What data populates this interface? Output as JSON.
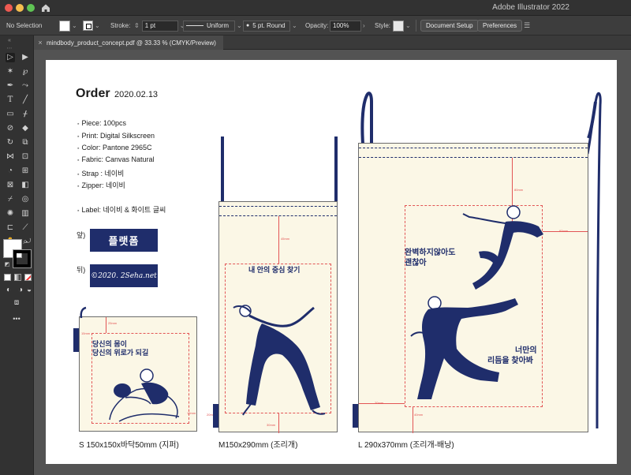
{
  "app": {
    "title": "Adobe Illustrator 2022"
  },
  "control_bar": {
    "selection": "No Selection",
    "stroke_label": "Stroke:",
    "stroke_weight": "1 pt",
    "profile": "Uniform",
    "brush": "5 pt. Round",
    "opacity_label": "Opacity:",
    "opacity_value": "100%",
    "style_label": "Style:",
    "document_setup": "Document Setup",
    "preferences": "Preferences"
  },
  "tab": {
    "name": "mindbody_product_concept.pdf @ 33.33 % (CMYK/Preview)"
  },
  "order": {
    "title": "Order",
    "date": "2020.02.13",
    "specs": [
      "Piece: 100pcs",
      "Print: Digital Silkscreen",
      "Color: Pantone 2965C",
      "Fabric: Canvas Natural",
      "Strap : 네이비",
      "Zipper: 네이비",
      "Label: 네이비 & 화이트 글씨"
    ],
    "front_label": "앞)",
    "back_label": "뒤)",
    "front_logo": "플랫폼",
    "back_logo": "©2020. 2Seha.net"
  },
  "bags": {
    "small": {
      "caption": "S 150x150x바닥50mm (지퍼)",
      "text_lines": [
        "당신의 몸이",
        "당신의 위로가 되길"
      ]
    },
    "medium": {
      "caption": "M150x290mm (조리개)",
      "text_lines": [
        "내 안의 중심 찾기"
      ]
    },
    "large": {
      "caption": "L 290x370mm (조리개-배낭)",
      "text_top": [
        "완벽하지않아도",
        "괜찮아"
      ],
      "text_bottom": [
        "너만의",
        "리듬을 찾아봐"
      ]
    }
  },
  "colors": {
    "navy": "#1f2d6b",
    "bag_fabric": "#fbf7e6",
    "guide_red": "#e25555"
  }
}
